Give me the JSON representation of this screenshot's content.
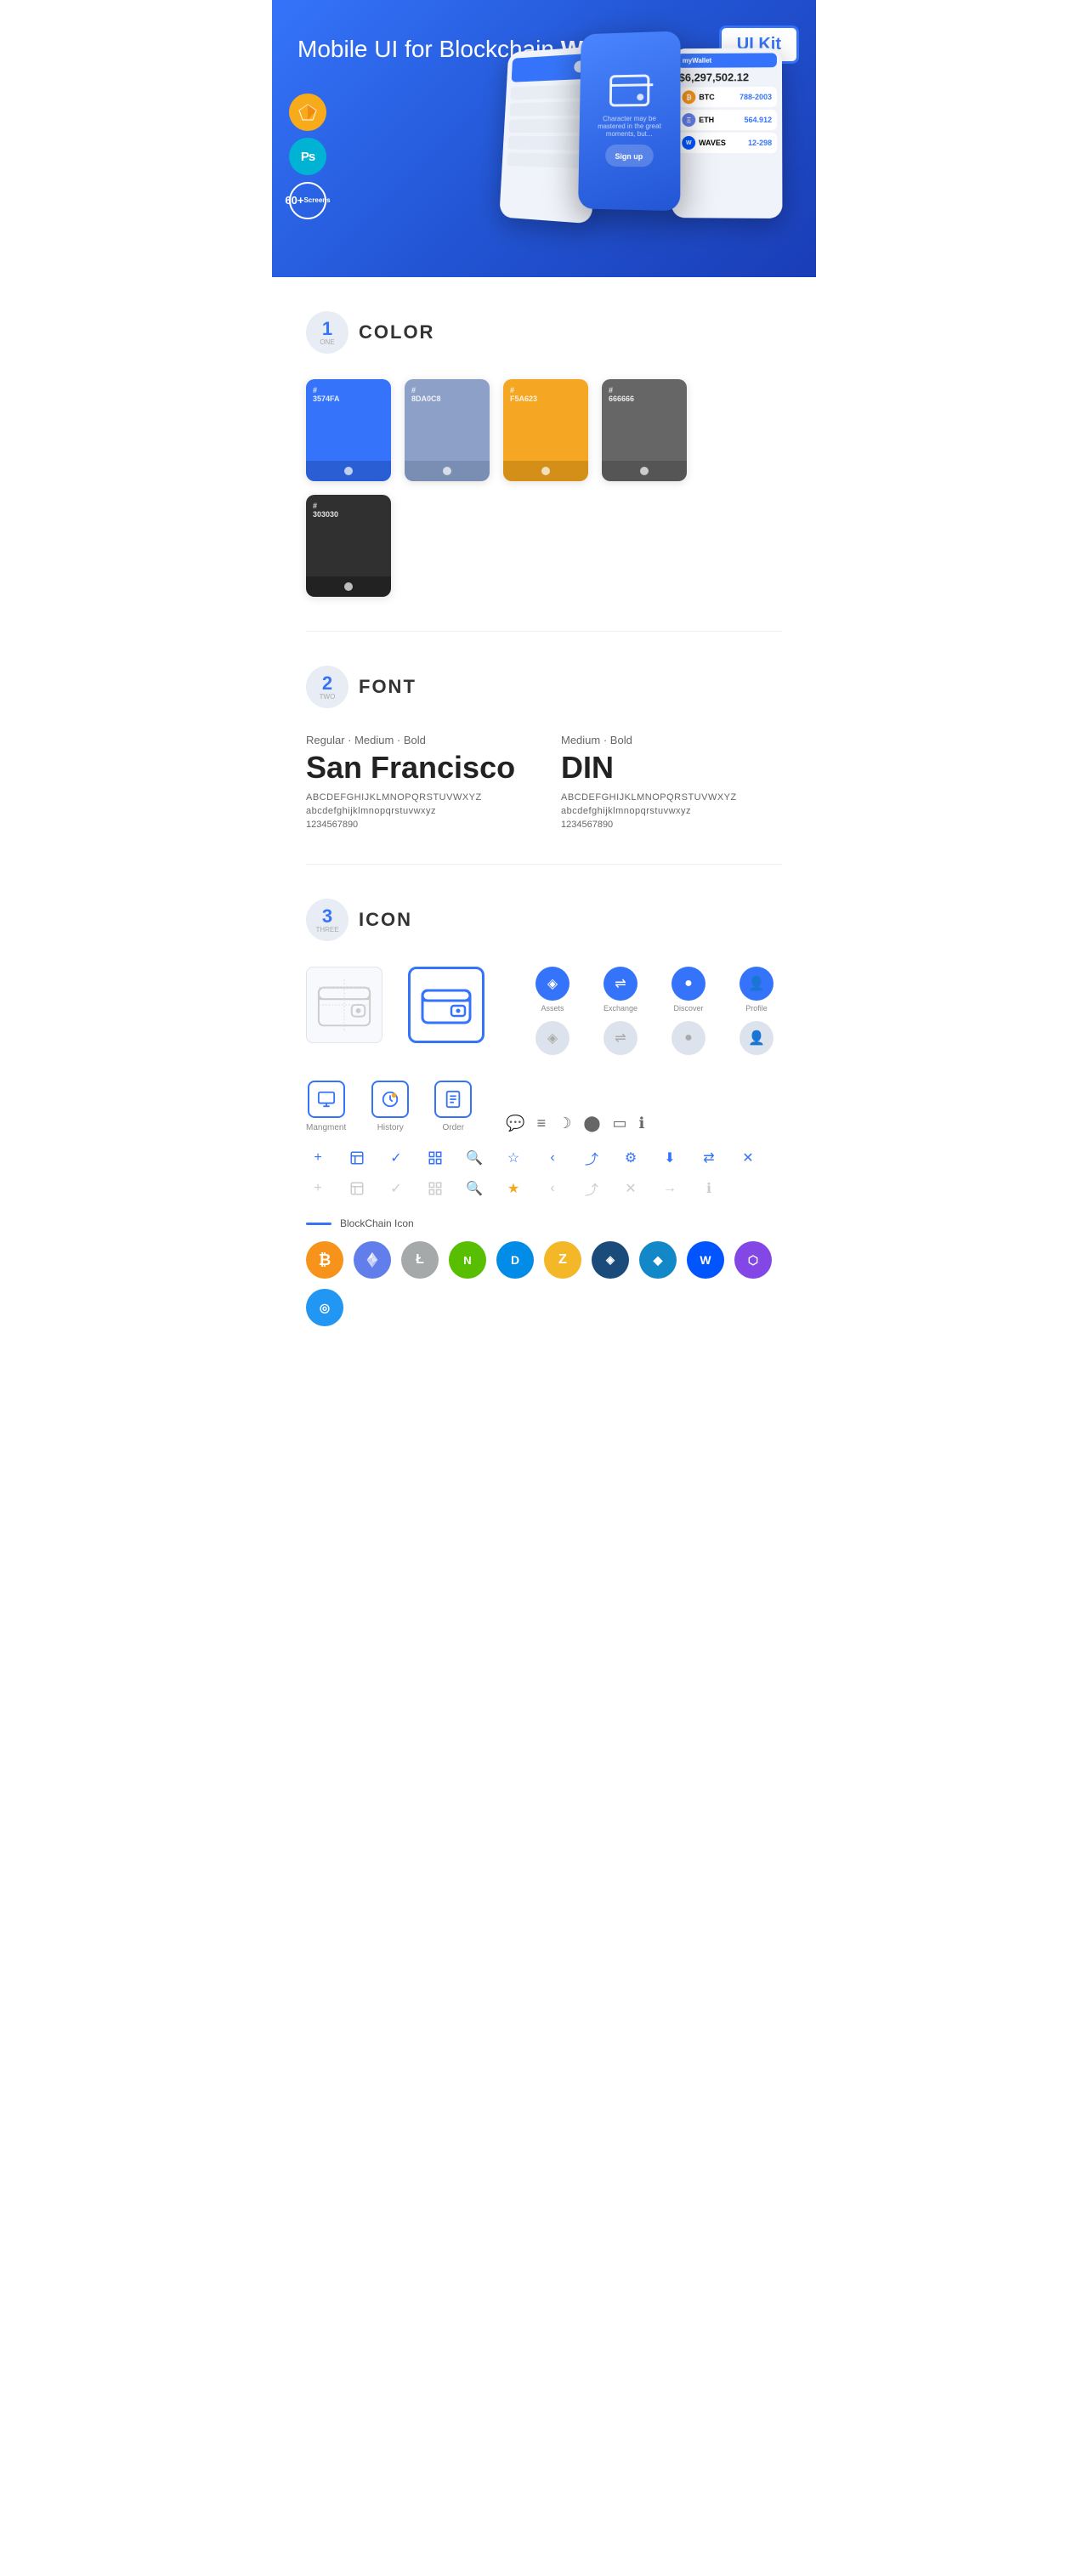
{
  "hero": {
    "title": "Mobile UI for Blockchain ",
    "title_bold": "Wallet",
    "ui_kit_badge": "UI Kit",
    "badge_sketch": "S",
    "badge_ps": "Ps",
    "badge_screens_num": "60+",
    "badge_screens_label": "Screens"
  },
  "sections": {
    "color": {
      "number": "1",
      "number_label": "ONE",
      "title": "COLOR",
      "swatches": [
        {
          "hex": "#3574FA",
          "code": "#\n3574FA"
        },
        {
          "hex": "#8DA0C8",
          "code": "#\n8DA0C8"
        },
        {
          "hex": "#F5A623",
          "code": "#\nF5A623"
        },
        {
          "hex": "#666666",
          "code": "#\n666666"
        },
        {
          "hex": "#303030",
          "code": "#\n303030"
        }
      ]
    },
    "font": {
      "number": "2",
      "number_label": "TWO",
      "title": "FONT",
      "fonts": [
        {
          "style": "Regular · Medium · Bold",
          "name": "San Francisco",
          "class": "",
          "uppercase": "ABCDEFGHIJKLMNOPQRSTUVWXYZ",
          "lowercase": "abcdefghijklmnopqrstuvwxyz",
          "numbers": "1234567890"
        },
        {
          "style": "Medium · Bold",
          "name": "DIN",
          "class": "din",
          "uppercase": "ABCDEFGHIJKLMNOPQRSTUVWXYZ",
          "lowercase": "abcdefghijklmnopqrstuvwxyz",
          "numbers": "1234567890"
        }
      ]
    },
    "icon": {
      "number": "3",
      "number_label": "THREE",
      "title": "ICON",
      "nav_icons": [
        {
          "label": "Assets",
          "color": "blue"
        },
        {
          "label": "Exchange",
          "color": "blue"
        },
        {
          "label": "Discover",
          "color": "blue"
        },
        {
          "label": "Profile",
          "color": "blue"
        }
      ],
      "mgmt_icons": [
        {
          "label": "Mangment"
        },
        {
          "label": "History"
        },
        {
          "label": "Order"
        }
      ],
      "blockchain_label": "BlockChain Icon",
      "crypto_coins": [
        {
          "label": "BTC",
          "class": "crypto-btc",
          "symbol": "₿"
        },
        {
          "label": "ETH",
          "class": "crypto-eth",
          "symbol": "Ξ"
        },
        {
          "label": "LTC",
          "class": "crypto-ltc",
          "symbol": "Ł"
        },
        {
          "label": "NEO",
          "class": "crypto-neo",
          "symbol": "N"
        },
        {
          "label": "DASH",
          "class": "crypto-dash",
          "symbol": "D"
        },
        {
          "label": "ZEC",
          "class": "crypto-zcash",
          "symbol": "Z"
        },
        {
          "label": "GRID",
          "class": "crypto-grid",
          "symbol": "◈"
        },
        {
          "label": "STRAT",
          "class": "crypto-stratis",
          "symbol": "S"
        },
        {
          "label": "WAVES",
          "class": "crypto-waves",
          "symbol": "W"
        },
        {
          "label": "MATIC",
          "class": "crypto-matic",
          "symbol": "M"
        },
        {
          "label": "SKY",
          "class": "crypto-skycoin",
          "symbol": "◎"
        }
      ]
    }
  }
}
